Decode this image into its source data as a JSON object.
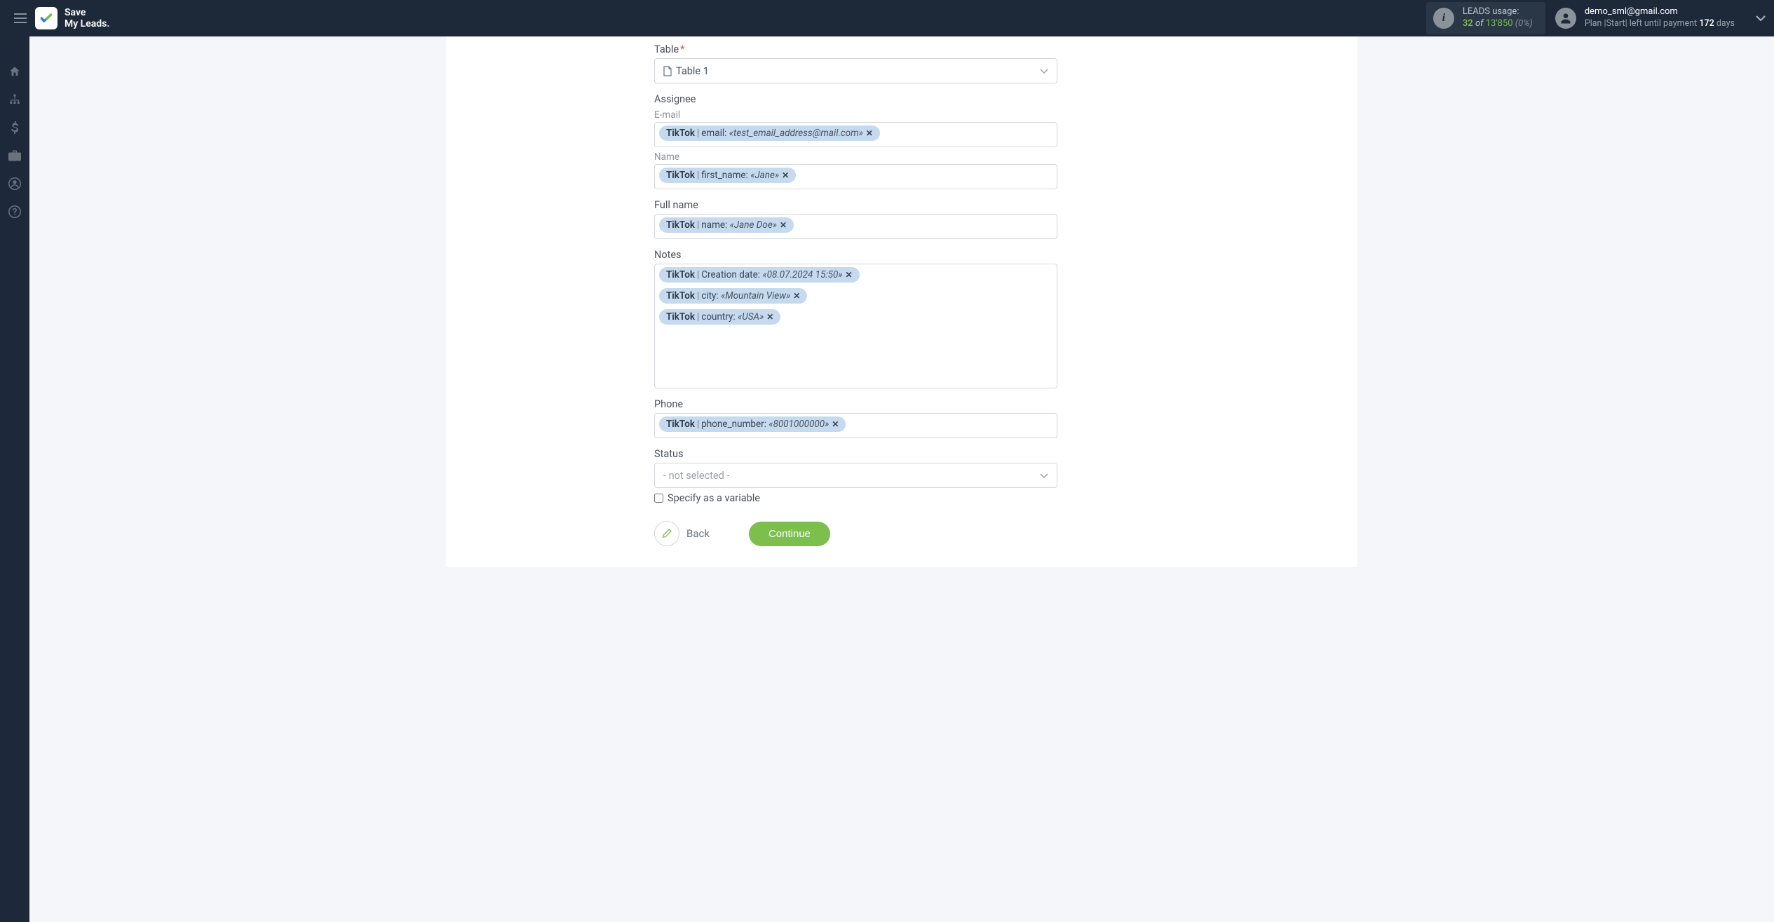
{
  "header": {
    "logo_line1": "Save",
    "logo_line2": "My Leads.",
    "usage_label": "LEADS usage:",
    "usage_used": "32",
    "usage_of": "of",
    "usage_total": "13'850",
    "usage_pct": "(0%)",
    "user_email": "demo_sml@gmail.com",
    "plan_prefix": "Plan |",
    "plan_name": "Start",
    "plan_mid": "| left until payment",
    "plan_days": "172",
    "plan_suffix": "days"
  },
  "form": {
    "table_label": "Table",
    "table_value": "Table 1",
    "assignee_label": "Assignee",
    "email_label": "E-mail",
    "email_tag": {
      "source": "TikTok",
      "field": "email:",
      "value": "«test_email_address@mail.com»"
    },
    "name_label": "Name",
    "name_tag": {
      "source": "TikTok",
      "field": "first_name:",
      "value": "«Jane»"
    },
    "fullname_label": "Full name",
    "fullname_tag": {
      "source": "TikTok",
      "field": "name:",
      "value": "«Jane Doe»"
    },
    "notes_label": "Notes",
    "notes_tags": [
      {
        "source": "TikTok",
        "field": "Creation date:",
        "value": "«08.07.2024 15:50»"
      },
      {
        "source": "TikTok",
        "field": "city:",
        "value": "«Mountain View»"
      },
      {
        "source": "TikTok",
        "field": "country:",
        "value": "«USA»"
      }
    ],
    "phone_label": "Phone",
    "phone_tag": {
      "source": "TikTok",
      "field": "phone_number:",
      "value": "«8001000000»"
    },
    "status_label": "Status",
    "status_placeholder": "- not selected -",
    "specify_label": "Specify as a variable",
    "back_label": "Back",
    "continue_label": "Continue"
  }
}
